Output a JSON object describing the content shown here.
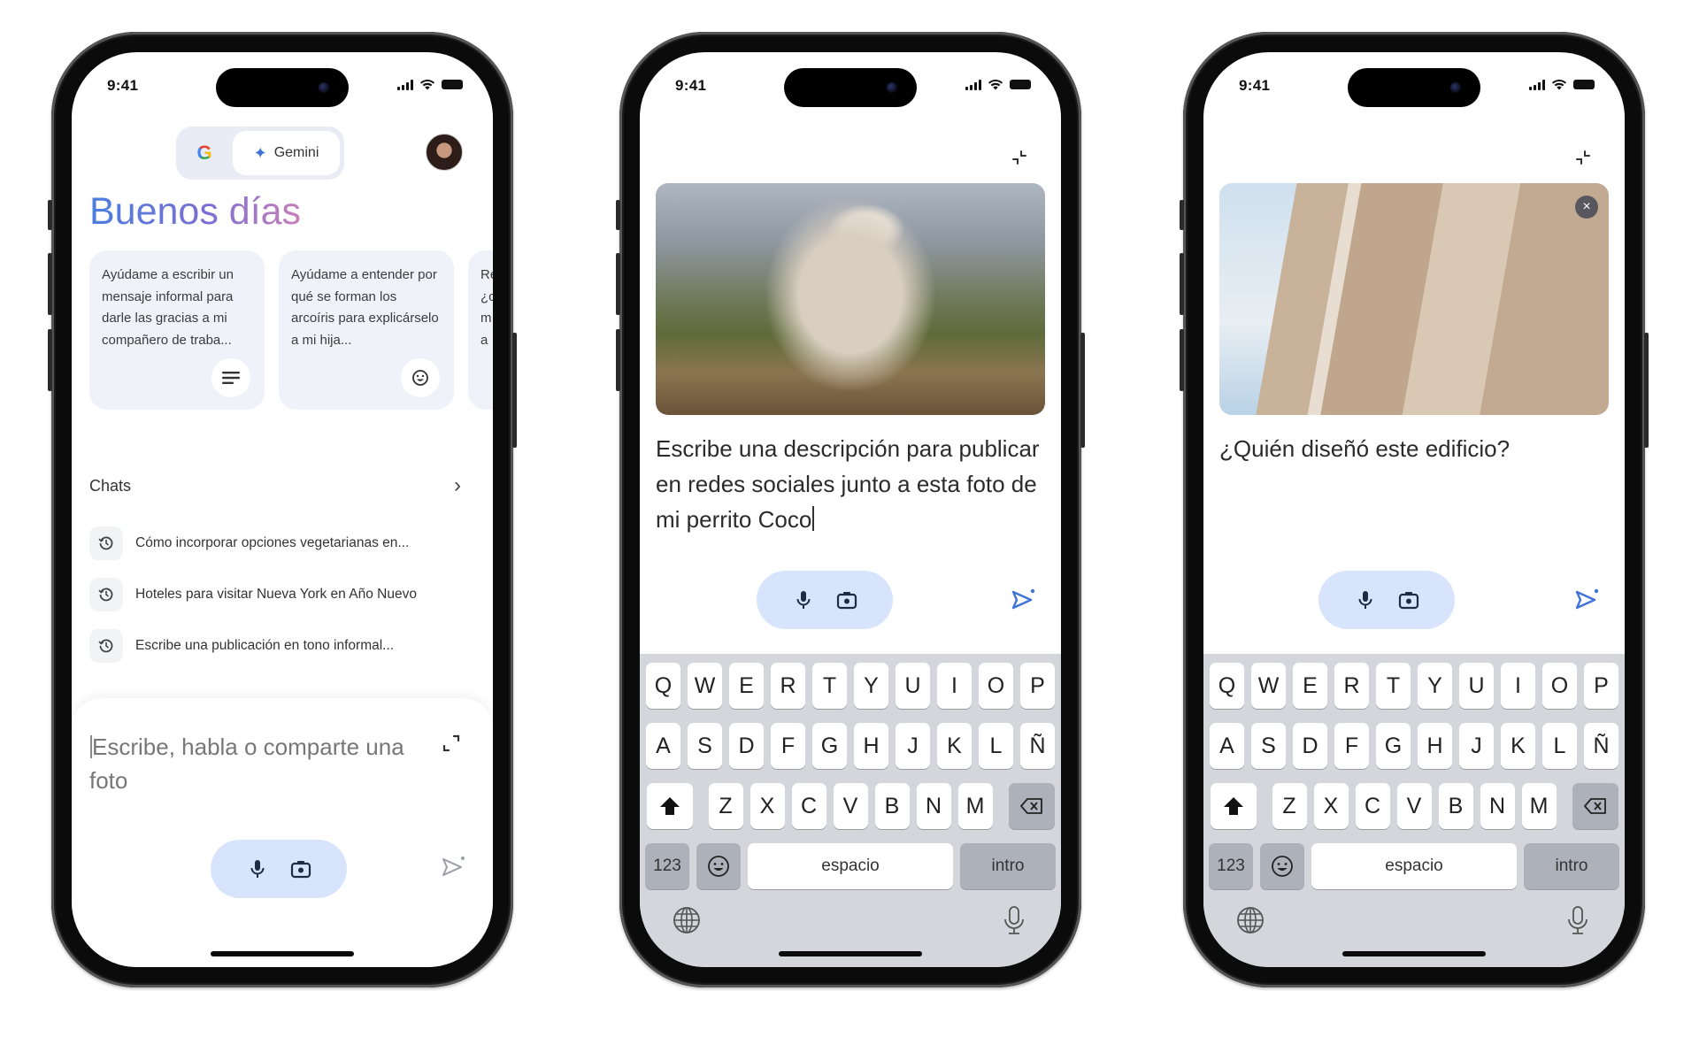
{
  "status_bar": {
    "time": "9:41"
  },
  "phone1": {
    "toggle": {
      "google_label": "G",
      "gemini_label": "Gemini",
      "active": "Gemini"
    },
    "greeting": "Buenos días",
    "suggestion_cards": [
      {
        "text": "Ayúdame a escribir un mensaje informal para darle las gracias a mi compañero de traba...",
        "icon": "lines-icon"
      },
      {
        "text": "Ayúdame a entender por qué se forman los arcoíris para explicárselo a mi hija...",
        "icon": "smiley-icon"
      },
      {
        "text": "Re ¿c m la",
        "icon": ""
      }
    ],
    "chats_title": "Chats",
    "chats": [
      {
        "label": "Cómo incorporar opciones vegetarianas en..."
      },
      {
        "label": "Hoteles para visitar Nueva York en Año Nuevo"
      },
      {
        "label": "Escribe una publicación en tono informal..."
      }
    ],
    "composer_placeholder": "Escribe, habla o comparte una foto"
  },
  "phone2": {
    "photo_alt": "Perro pequeño de pelo gris y blanco en el campo",
    "prompt": "Escribe una descripción para publicar en redes sociales junto a esta foto de mi perrito Coco"
  },
  "phone3": {
    "photo_alt": "Fachada de la Sagrada Familia",
    "prompt": "¿Quién diseñó este edificio?",
    "close_label": "×"
  },
  "keyboard": {
    "row1": [
      "Q",
      "W",
      "E",
      "R",
      "T",
      "Y",
      "U",
      "I",
      "O",
      "P"
    ],
    "row2": [
      "A",
      "S",
      "D",
      "F",
      "G",
      "H",
      "J",
      "K",
      "L",
      "Ñ"
    ],
    "row3": [
      "Z",
      "X",
      "C",
      "V",
      "B",
      "N",
      "M"
    ],
    "numbers_label": "123",
    "space_label": "espacio",
    "return_label": "intro"
  },
  "colors": {
    "accent_blue": "#3f73d8",
    "pill_bg": "#d7e4fb",
    "card_bg": "#eff2f8",
    "keyboard_bg": "#d4d6dc"
  }
}
